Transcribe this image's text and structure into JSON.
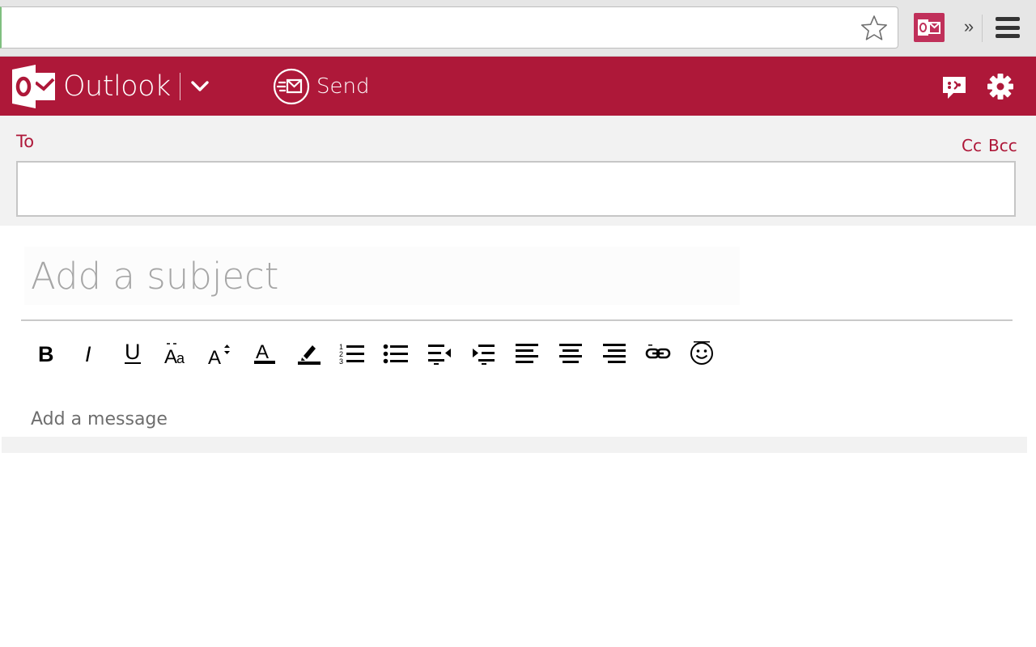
{
  "browser": {
    "address_value": "",
    "bookmark_icon": "star-icon",
    "extension_icon": "outlook-extension-icon",
    "more_label": "»",
    "menu_icon": "hamburger-menu-icon"
  },
  "header": {
    "app_name": "Outlook",
    "brand_color": "#ae1839",
    "dropdown_icon": "chevron-down-icon",
    "send_label": "Send",
    "feedback_icon": "feedback-icon",
    "settings_icon": "gear-icon"
  },
  "recipients": {
    "to_label": "To",
    "to_value": "",
    "cc_label": "Cc",
    "bcc_label": "Bcc"
  },
  "compose": {
    "subject_placeholder": "Add a subject",
    "subject_value": "",
    "message_placeholder": "Add a message",
    "toolbar": [
      {
        "name": "bold-button",
        "icon": "bold-icon"
      },
      {
        "name": "italic-button",
        "icon": "italic-icon"
      },
      {
        "name": "underline-button",
        "icon": "underline-icon"
      },
      {
        "name": "font-button",
        "icon": "font-icon"
      },
      {
        "name": "font-size-button",
        "icon": "font-size-icon"
      },
      {
        "name": "font-color-button",
        "icon": "font-color-icon"
      },
      {
        "name": "highlight-button",
        "icon": "highlight-icon"
      },
      {
        "name": "numbered-list-button",
        "icon": "numbered-list-icon"
      },
      {
        "name": "bulleted-list-button",
        "icon": "bulleted-list-icon"
      },
      {
        "name": "decrease-indent-button",
        "icon": "decrease-indent-icon"
      },
      {
        "name": "increase-indent-button",
        "icon": "increase-indent-icon"
      },
      {
        "name": "align-left-button",
        "icon": "align-left-icon"
      },
      {
        "name": "align-center-button",
        "icon": "align-center-icon"
      },
      {
        "name": "align-right-button",
        "icon": "align-right-icon"
      },
      {
        "name": "insert-link-button",
        "icon": "link-icon"
      },
      {
        "name": "emoji-button",
        "icon": "emoji-icon"
      }
    ]
  }
}
